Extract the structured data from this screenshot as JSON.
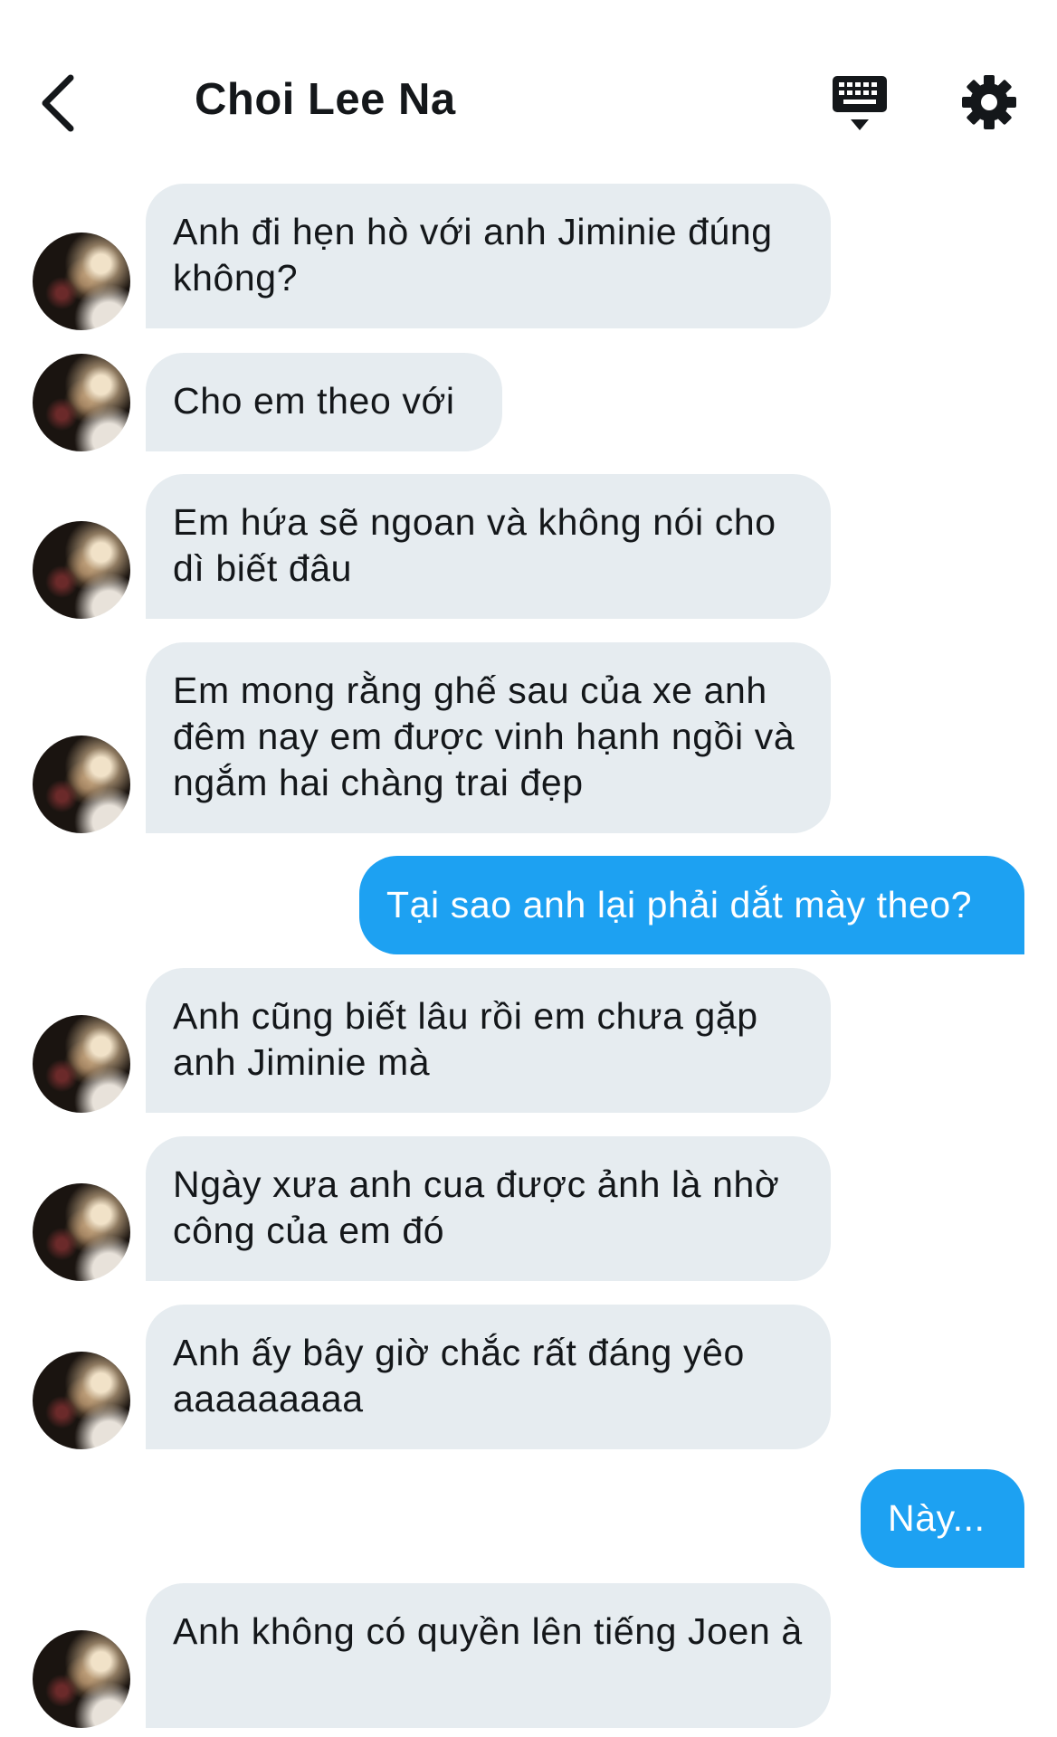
{
  "header": {
    "title": "Choi Lee Na",
    "back_icon": "chevron-left-icon",
    "keyboard_icon": "keyboard-icon",
    "settings_icon": "gear-icon"
  },
  "colors": {
    "incoming_bubble": "#e6ecf0",
    "outgoing_bubble": "#1da1f2",
    "text": "#14171a"
  },
  "messages": [
    {
      "from": "them",
      "text": "Anh đi hẹn hò với anh Jiminie đúng không?"
    },
    {
      "from": "them",
      "text": "Cho em theo với"
    },
    {
      "from": "them",
      "text": "Em hứa sẽ ngoan và không nói cho dì biết đâu"
    },
    {
      "from": "them",
      "text": "Em mong rằng ghế sau của xe anh đêm nay em được vinh hạnh ngồi và ngắm hai chàng trai đẹp"
    },
    {
      "from": "me",
      "text": "Tại sao anh lại phải dắt mày theo?"
    },
    {
      "from": "them",
      "text": "Anh cũng biết lâu rồi em chưa gặp anh Jiminie mà"
    },
    {
      "from": "them",
      "text": "Ngày xưa anh cua được ảnh là nhờ công của em đó"
    },
    {
      "from": "them",
      "text": "Anh ấy bây giờ chắc rất đáng yêo aaaaaaaaa"
    },
    {
      "from": "me",
      "text": "Này..."
    },
    {
      "from": "them",
      "text": "Anh không có quyền lên tiếng Joen à"
    }
  ]
}
